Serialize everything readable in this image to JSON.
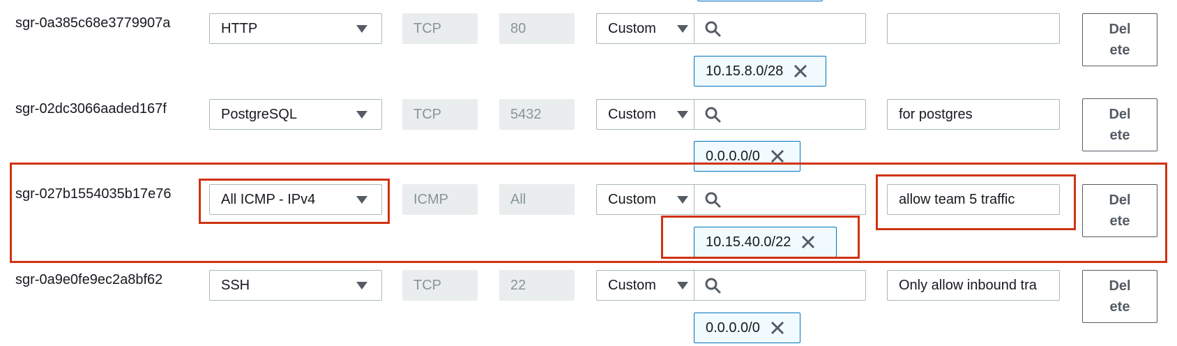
{
  "rules": [
    {
      "id": "sgr-0a385c68e3779907a",
      "type": "HTTP",
      "protocol": "TCP",
      "port_range": "80",
      "source_type": "Custom",
      "source_cidr": "10.15.8.0/28",
      "description": "",
      "delete_line1": "Del",
      "delete_line2": "ete"
    },
    {
      "id": "sgr-02dc3066aaded167f",
      "type": "PostgreSQL",
      "protocol": "TCP",
      "port_range": "5432",
      "source_type": "Custom",
      "source_cidr": "0.0.0.0/0",
      "description": "for postgres",
      "delete_line1": "Del",
      "delete_line2": "ete"
    },
    {
      "id": "sgr-027b1554035b17e76",
      "type": "All ICMP - IPv4",
      "protocol": "ICMP",
      "port_range": "All",
      "source_type": "Custom",
      "source_cidr": "10.15.40.0/22",
      "description": "allow team 5 traffic",
      "delete_line1": "Del",
      "delete_line2": "ete"
    },
    {
      "id": "sgr-0a9e0fe9ec2a8bf62",
      "type": "SSH",
      "protocol": "TCP",
      "port_range": "22",
      "source_type": "Custom",
      "source_cidr": "0.0.0.0/0",
      "description": "Only allow inbound tra",
      "delete_line1": "Del",
      "delete_line2": "ete"
    }
  ],
  "icons": {
    "caret": "chevron-down-icon",
    "search": "search-icon",
    "remove": "close-icon"
  },
  "colors": {
    "highlight": "#d13212",
    "token_border": "#0073bb",
    "token_bg": "#f1faff",
    "readonly_bg": "#eaeded"
  }
}
